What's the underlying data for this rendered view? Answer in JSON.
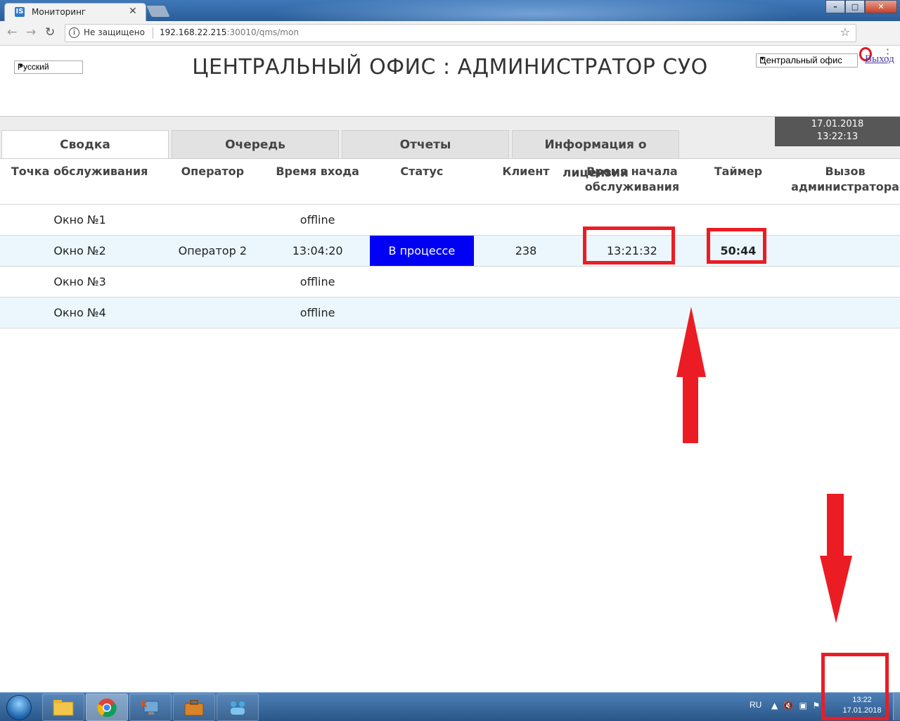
{
  "browser": {
    "tab_title": "Мониторинг",
    "tab_favicon": "IS",
    "security_label": "Не защищено",
    "url_host": "192.168.22.215",
    "url_rest": ":30010/qms/mon"
  },
  "header": {
    "language": "Русский",
    "title": "ЦЕНТРАЛЬНЫЙ ОФИС : АДМИНИСТРАТОР СУО",
    "office": "Центральный офис",
    "logout": "Выход",
    "clock_date": "17.01.2018",
    "clock_time": "13:22:13"
  },
  "tabs": [
    {
      "label": "Сводка",
      "active": true
    },
    {
      "label": "Очередь",
      "active": false
    },
    {
      "label": "Отчеты",
      "active": false
    },
    {
      "label": "Информация о лицензии",
      "active": false
    }
  ],
  "table": {
    "columns": [
      "Точка обслуживания",
      "Оператор",
      "Время входа",
      "Статус",
      "Клиент",
      "Время начала обслуживания",
      "Таймер",
      "Вызов администратора"
    ],
    "rows": [
      {
        "point": "Окно №1",
        "operator": "",
        "login": "offline",
        "status": "",
        "client": "",
        "start": "",
        "timer": "",
        "call": ""
      },
      {
        "point": "Окно №2",
        "operator": "Оператор 2",
        "login": "13:04:20",
        "status": "В процессе",
        "client": "238",
        "start": "13:21:32",
        "timer": "50:44",
        "call": ""
      },
      {
        "point": "Окно №3",
        "operator": "",
        "login": "offline",
        "status": "",
        "client": "",
        "start": "",
        "timer": "",
        "call": ""
      },
      {
        "point": "Окно №4",
        "operator": "",
        "login": "offline",
        "status": "",
        "client": "",
        "start": "",
        "timer": "",
        "call": ""
      }
    ]
  },
  "taskbar": {
    "lang": "RU",
    "time": "13:22",
    "date": "17.01.2018"
  },
  "colors": {
    "status_in_progress": "#0000f5",
    "timer": "#e02020",
    "annotation": "#ec1c24"
  }
}
